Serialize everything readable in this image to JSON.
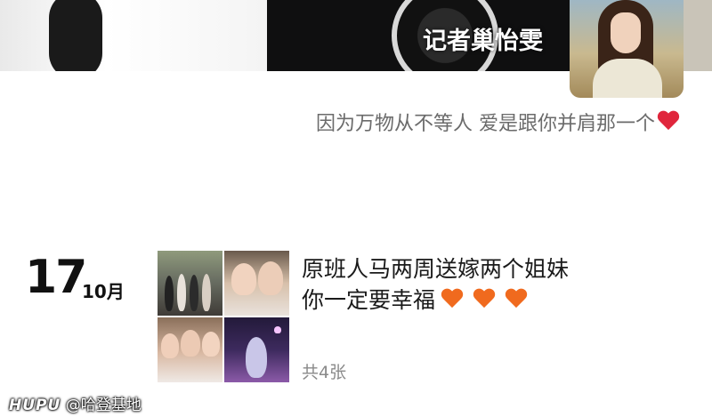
{
  "cover": {
    "author_overlay": "记者巢怡雯"
  },
  "profile": {
    "signature": "因为万物从不等人 爱是跟你并肩那一个",
    "signature_heart_color": "#e0263c"
  },
  "post": {
    "day": "17",
    "month": "10月",
    "text_line_1": "原班人马两周送嫁两个姐妹",
    "text_line_2": "你一定要幸福",
    "hearts_color": "#f06a1e",
    "heart_count": 3,
    "photo_count_label": "共4张"
  },
  "watermark": {
    "brand": "HUPU",
    "handle": "@哈登基地"
  }
}
